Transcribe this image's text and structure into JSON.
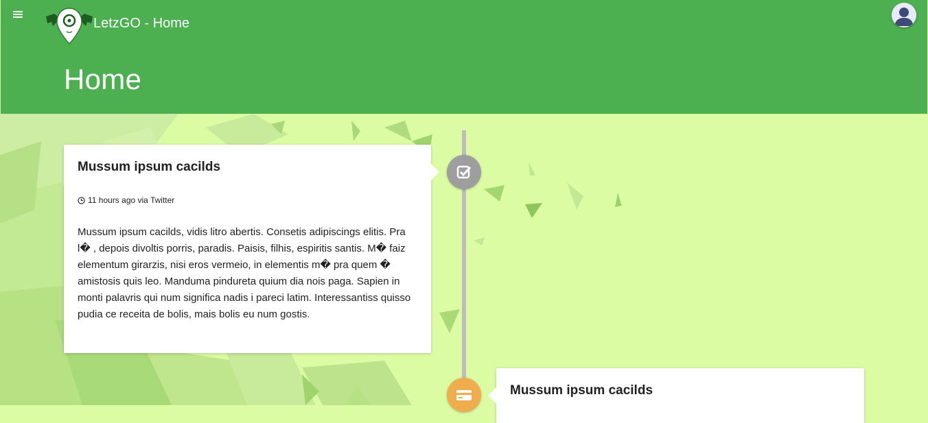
{
  "app_bar": {
    "title": "LetzGO - Home",
    "page_title": "Home",
    "color": "#4caf50"
  },
  "icons": {
    "menu": "hamburger-menu-icon",
    "logo": "letzgo-logo",
    "avatar": "user-avatar",
    "event_1": "check-square-icon",
    "event_2": "credit-card-icon",
    "meta": "clock-icon"
  },
  "timeline": {
    "items": [
      {
        "title": "Mussum ipsum cacilds",
        "meta": "11 hours ago via Twitter",
        "body": "Mussum ipsum cacilds, vidis litro abertis. Consetis adipiscings elitis. Pra l� , depois divoltis porris, paradis. Paisis, filhis, espiritis santis. M� faiz elementum girarzis, nisi eros vermeio, in elementis m� pra quem � amistosis quis leo. Manduma pindureta quium dia nois paga. Sapien in monti palavris qui num significa nadis i pareci latim. Interessantiss quisso pudia ce receita de bolis, mais bolis eu num gostis.",
        "icon_color": "#9e9e9e"
      },
      {
        "title": "Mussum ipsum cacilds",
        "icon_color": "#f0ad4e"
      }
    ]
  }
}
